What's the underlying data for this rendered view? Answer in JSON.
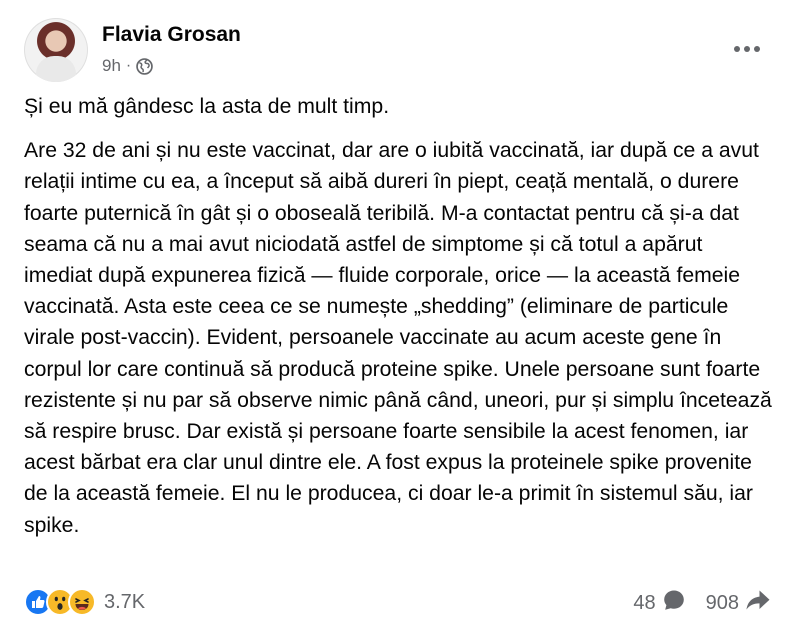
{
  "post": {
    "author": "Flavia Grosan",
    "time": "9h",
    "separator": "·",
    "paragraphs": [
      "Și eu mă gândesc la asta de mult timp.",
      "Are 32 de ani și nu este vaccinat, dar are o iubită vaccinată, iar după ce a avut relații intime cu ea, a început să aibă dureri în piept, ceață mentală, o durere foarte puternică în gât și o oboseală teribilă. M-a contactat pentru că și-a dat seama că nu a mai avut niciodată astfel de simptome și că totul a apărut imediat după expunerea fizică — fluide corporale, orice — la această femeie vaccinată. Asta este ceea ce se numește „shedding” (eliminare de particule virale post-vaccin). Evident, persoanele vaccinate au acum aceste gene în corpul lor care continuă să producă proteine spike. Unele persoane sunt foarte rezistente și nu par să observe nimic până când, uneori, pur și simplu încetează să respire brusc. Dar există și persoane foarte sensibile la acest fenomen, iar acest bărbat era clar unul dintre ele. A fost expus la proteinele spike provenite de la această femeie. El nu le producea, ci doar le-a primit în sistemul său, iar spike."
    ]
  },
  "footer": {
    "reactions": [
      "like",
      "wow",
      "haha"
    ],
    "reaction_count": "3.7K",
    "comments": "48",
    "shares": "908"
  },
  "icons": {
    "privacy": "globe-icon",
    "menu": "more-options-icon",
    "comments": "comment-icon",
    "shares": "share-icon"
  },
  "colors": {
    "like": "#1877f2",
    "reaction_yellow": "#f7b928",
    "secondary_text": "#65676b"
  }
}
